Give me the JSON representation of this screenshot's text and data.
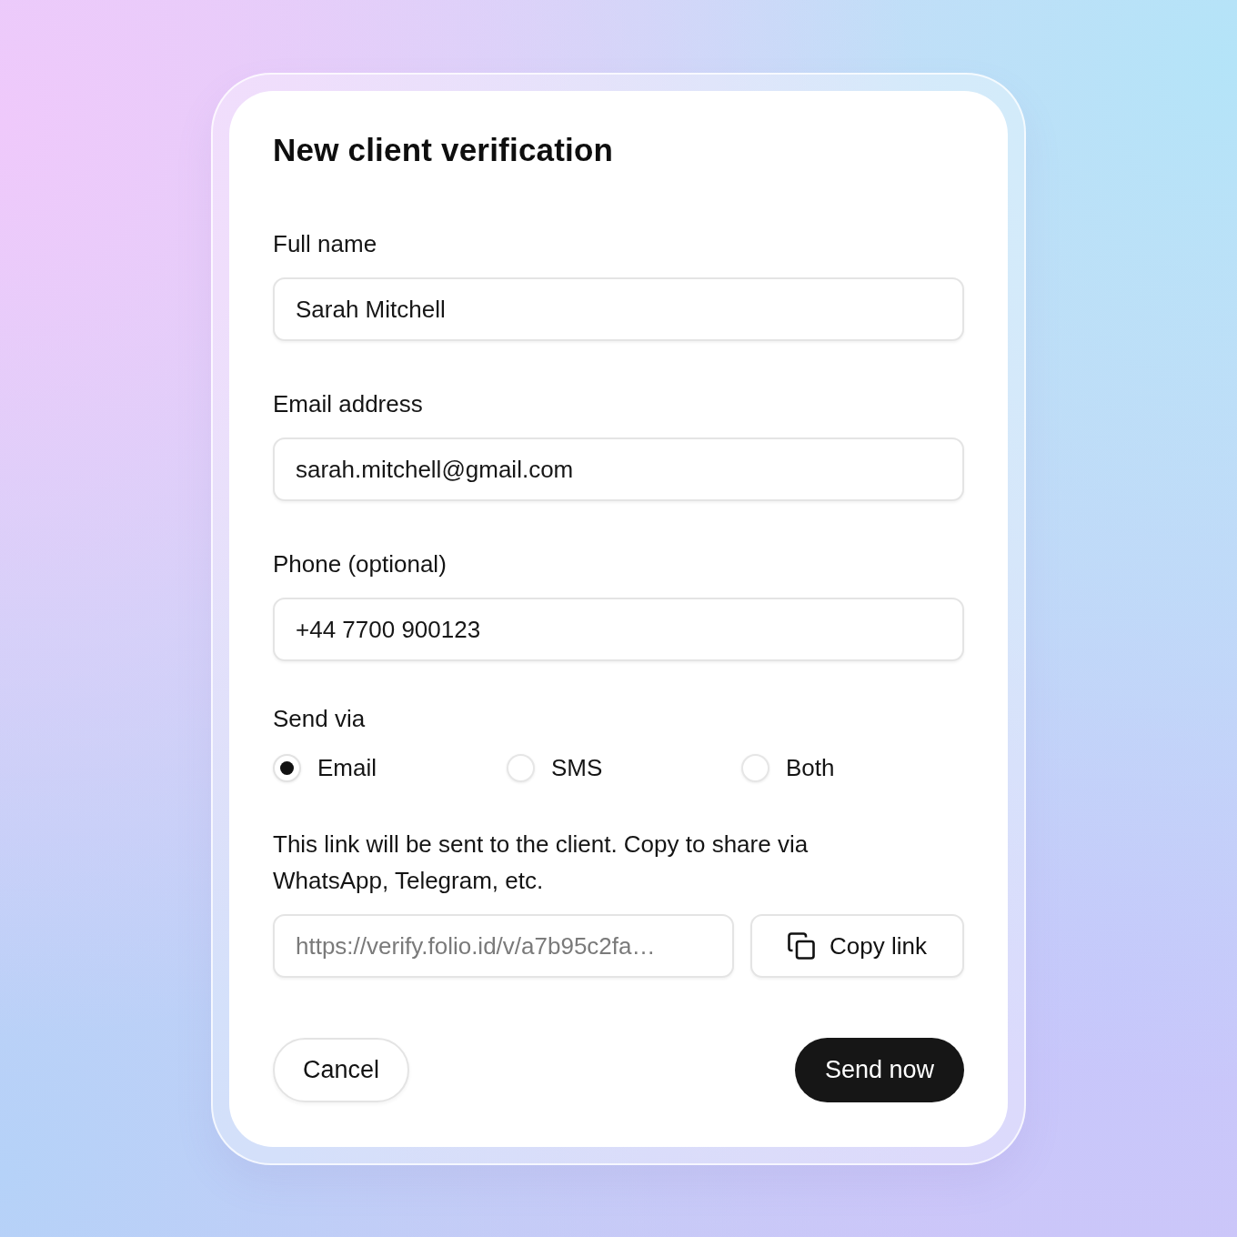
{
  "dialog": {
    "title": "New client verification"
  },
  "fields": [
    {
      "label": "Full name",
      "value": "Sarah Mitchell"
    },
    {
      "label": "Email address",
      "value": "sarah.mitchell@gmail.com"
    },
    {
      "label": "Phone (optional)",
      "value": "+44 7700 900123"
    }
  ],
  "send_via": {
    "label": "Send via",
    "options": [
      {
        "label": "Email",
        "selected": true
      },
      {
        "label": "SMS",
        "selected": false
      },
      {
        "label": "Both",
        "selected": false
      }
    ]
  },
  "share": {
    "note": "This link will be sent to the client. Copy to share via WhatsApp, Telegram, etc.",
    "link": "https://verify.folio.id/v/a7b95c2fa…",
    "copy_button": "Copy link"
  },
  "buttons": [
    {
      "label": "Cancel",
      "kind": "secondary"
    },
    {
      "label": "Send now",
      "kind": "primary"
    }
  ]
}
